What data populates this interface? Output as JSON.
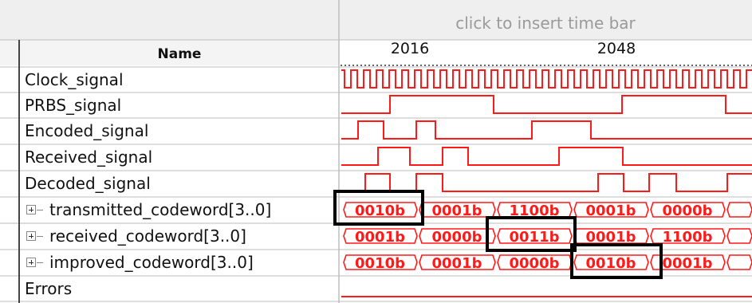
{
  "timebar_hint": "click to insert time bar",
  "header": {
    "name_column": "Name"
  },
  "time_ticks": [
    "2016",
    "2048"
  ],
  "colors": {
    "waveform": "#ff1a1a",
    "grid": "#bdbdbd",
    "header_bg": "#efefef",
    "highlight_box": "#000000"
  },
  "signals": [
    {
      "name": "Clock_signal",
      "kind": "bit",
      "expandable": false
    },
    {
      "name": "PRBS_signal",
      "kind": "bit",
      "expandable": false
    },
    {
      "name": "Encoded_signal",
      "kind": "bit",
      "expandable": false
    },
    {
      "name": "Received_signal",
      "kind": "bit",
      "expandable": false
    },
    {
      "name": "Decoded_signal",
      "kind": "bit",
      "expandable": false
    },
    {
      "name": "transmitted_codeword[3..0]",
      "kind": "bus",
      "expandable": true,
      "values": [
        "0010b",
        "0001b",
        "1100b",
        "0001b",
        "0000b",
        ""
      ]
    },
    {
      "name": "received_codeword[3..0]",
      "kind": "bus",
      "expandable": true,
      "values": [
        "0001b",
        "0000b",
        "0011b",
        "0001b",
        "1100b",
        ""
      ]
    },
    {
      "name": "improved_codeword[3..0]",
      "kind": "bus",
      "expandable": true,
      "values": [
        "0010b",
        "0001b",
        "0000b",
        "0010b",
        "0001b",
        ""
      ]
    },
    {
      "name": "Errors",
      "kind": "bit",
      "expandable": false
    }
  ]
}
